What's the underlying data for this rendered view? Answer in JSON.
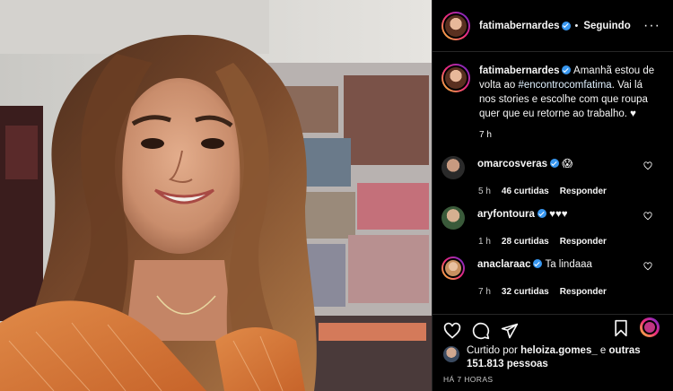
{
  "post": {
    "username": "fatimabernardes",
    "follow_status": "Seguindo",
    "dot": "•",
    "more": "···",
    "caption_before": "Amanhã estou de volta ao ",
    "caption_hashtag": "#encontrocomfatima",
    "caption_after": ". Vai lá nos stories e escolhe com que roupa quer que eu retorne ao trabalho. ♥",
    "caption_time": "7 h"
  },
  "comments": [
    {
      "username": "omarcosveras",
      "text": "😱",
      "time": "5 h",
      "likes": "46 curtidas",
      "reply": "Responder"
    },
    {
      "username": "aryfontoura",
      "text": "♥♥♥",
      "time": "1 h",
      "likes": "28 curtidas",
      "reply": "Responder"
    },
    {
      "username": "anaclaraac",
      "text": "Ta lindaaa",
      "time": "7 h",
      "likes": "32 curtidas",
      "reply": "Responder"
    }
  ],
  "likes_bar": {
    "prefix": "Curtido por ",
    "user": "heloiza.gomes_",
    "middle": " e ",
    "others": "outras 151.813 pessoas",
    "ago": "HÁ 7 HORAS"
  },
  "colors": {
    "verified": "#3897f0",
    "panel_bg": "#000000",
    "divider": "#262626"
  }
}
